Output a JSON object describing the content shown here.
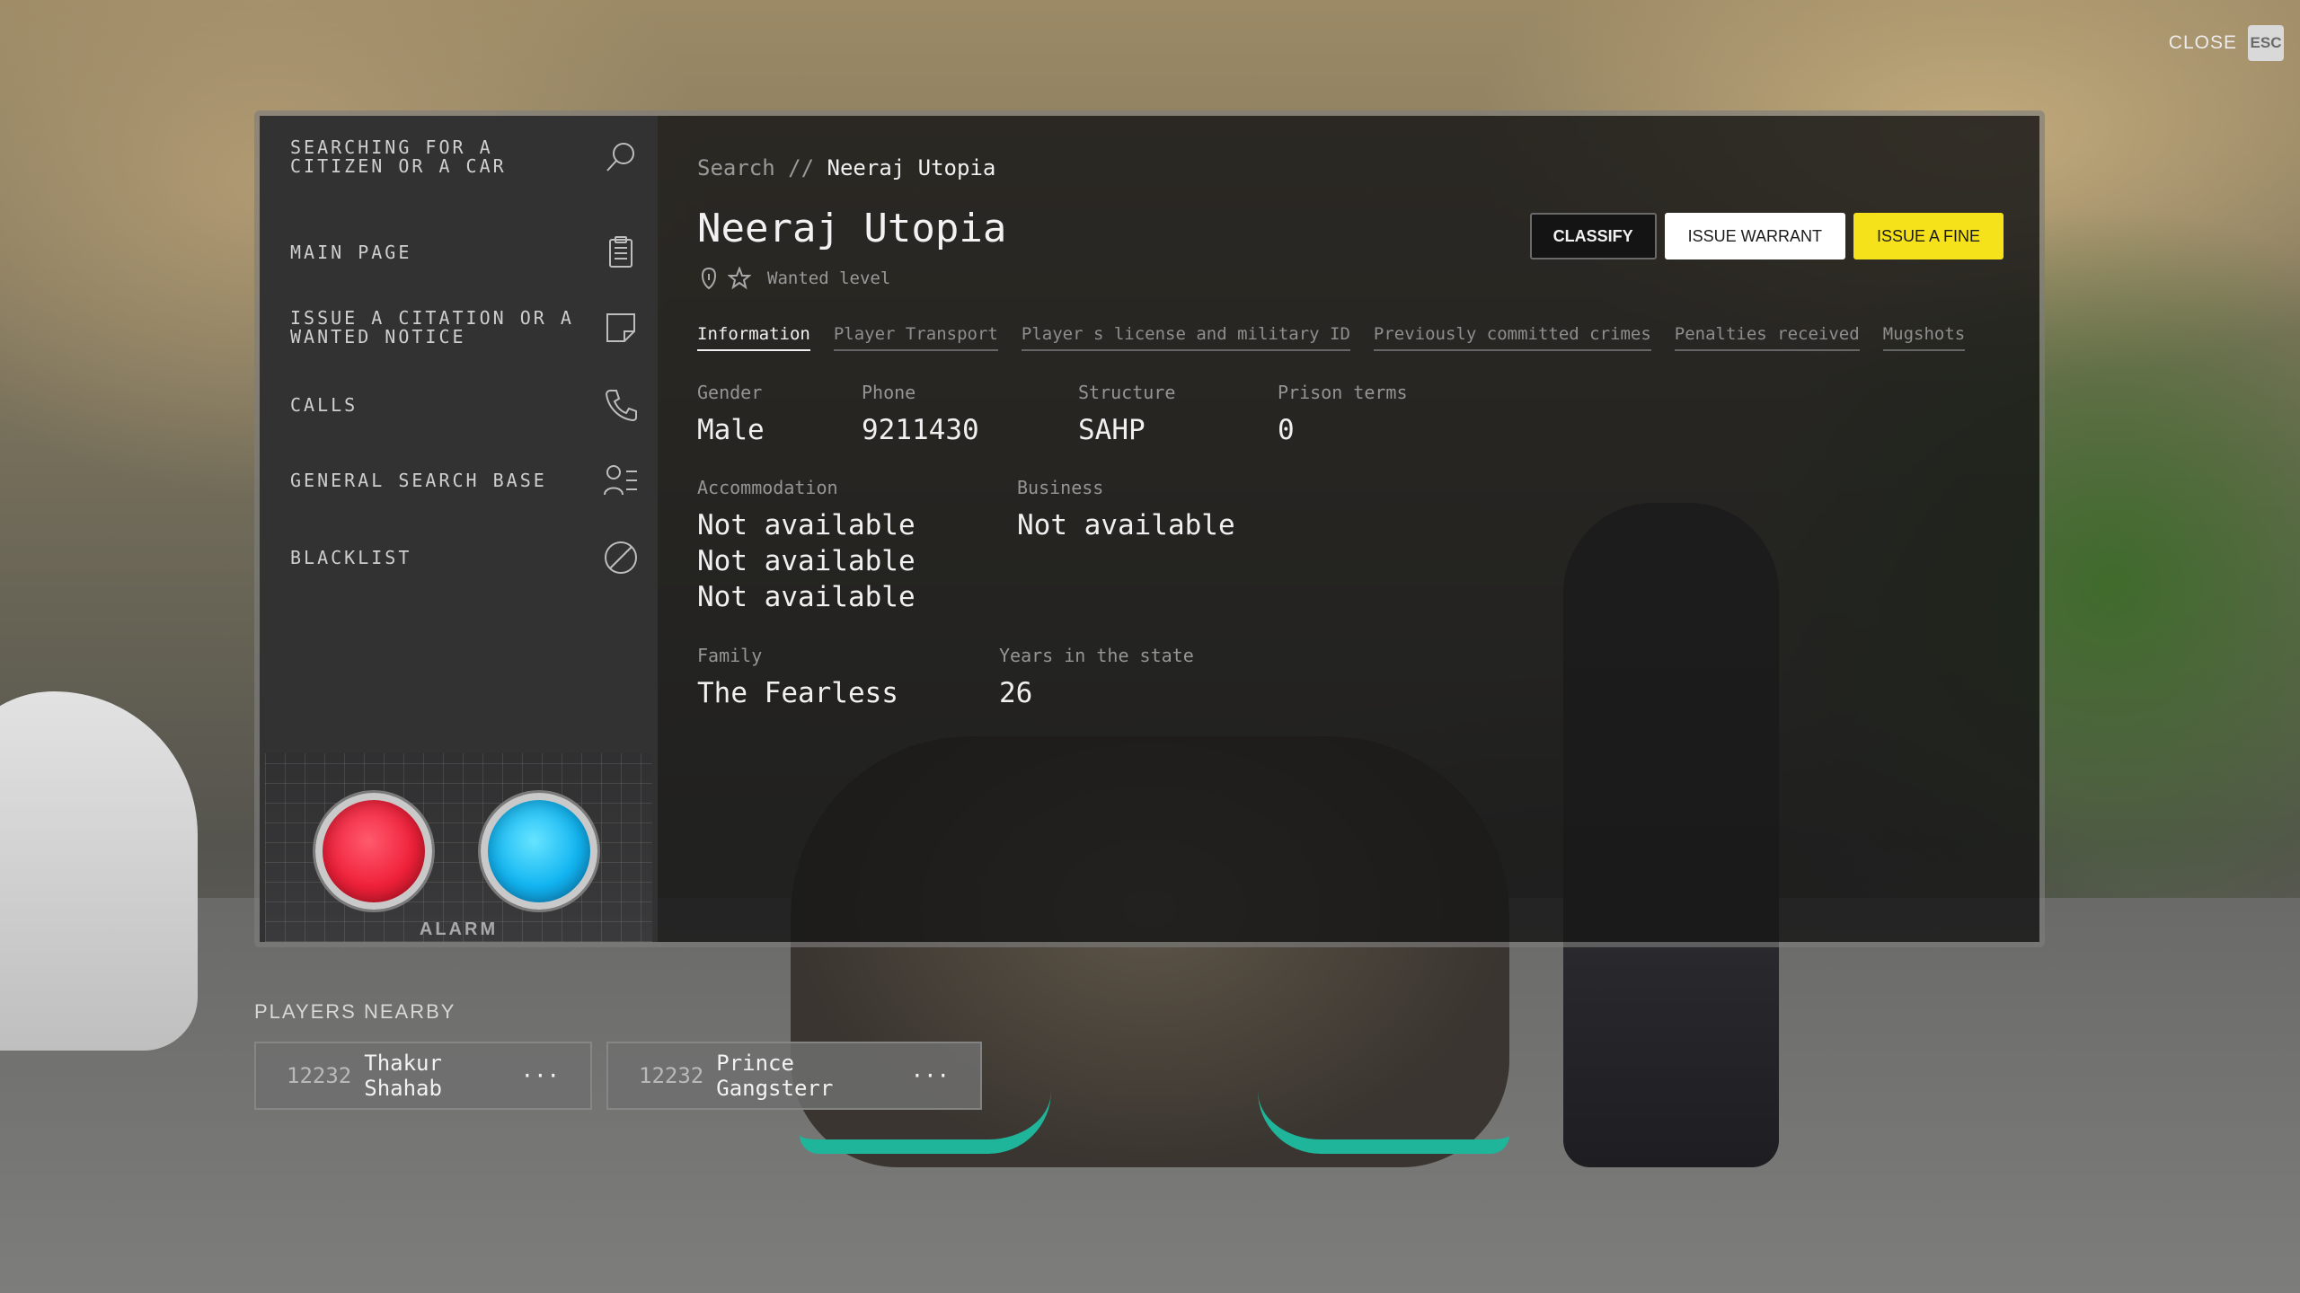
{
  "close": {
    "label": "CLOSE",
    "key": "ESC"
  },
  "sidebar": {
    "items": [
      {
        "label": "SEARCHING FOR A CITIZEN OR A CAR",
        "icon": "search-icon"
      },
      {
        "label": "MAIN PAGE",
        "icon": "clipboard-icon"
      },
      {
        "label": "ISSUE A CITATION OR A WANTED NOTICE",
        "icon": "note-icon"
      },
      {
        "label": "CALLS",
        "icon": "phone-icon"
      },
      {
        "label": "GENERAL SEARCH BASE",
        "icon": "user-list-icon"
      },
      {
        "label": "BLACKLIST",
        "icon": "block-icon"
      }
    ],
    "alarm_label": "ALARM"
  },
  "breadcrumb": {
    "root": "Search",
    "separator": "//",
    "current": "Neeraj Utopia"
  },
  "profile": {
    "name": "Neeraj Utopia",
    "wanted_level": 0,
    "wanted_label": "Wanted level"
  },
  "actions": {
    "classify": "CLASSIFY",
    "warrant": "ISSUE WARRANT",
    "fine": "ISSUE A FINE"
  },
  "tabs": [
    {
      "label": "Information",
      "active": true
    },
    {
      "label": "Player Transport",
      "active": false
    },
    {
      "label": "Player s license and military ID",
      "active": false
    },
    {
      "label": "Previously committed crimes",
      "active": false
    },
    {
      "label": "Penalties received",
      "active": false
    },
    {
      "label": "Mugshots",
      "active": false
    }
  ],
  "info": {
    "gender": {
      "label": "Gender",
      "value": "Male"
    },
    "phone": {
      "label": "Phone",
      "value": "9211430"
    },
    "structure": {
      "label": "Structure",
      "value": "SAHP"
    },
    "prison": {
      "label": "Prison terms",
      "value": "0"
    },
    "accommodation": {
      "label": "Accommodation",
      "values": [
        "Not available",
        "Not available",
        "Not available"
      ]
    },
    "business": {
      "label": "Business",
      "value": "Not available"
    },
    "family": {
      "label": "Family",
      "value": "The Fearless"
    },
    "years": {
      "label": "Years in the state",
      "value": "26"
    }
  },
  "nearby": {
    "title": "PLAYERS NEARBY",
    "players": [
      {
        "id": "12232",
        "name": "Thakur Shahab",
        "more": "···"
      },
      {
        "id": "12232",
        "name": "Prince Gangsterr",
        "more": "···"
      }
    ]
  },
  "colors": {
    "accent_yellow": "#f6e21b",
    "alarm_red": "#f0213a",
    "alarm_blue": "#12b5f2"
  }
}
